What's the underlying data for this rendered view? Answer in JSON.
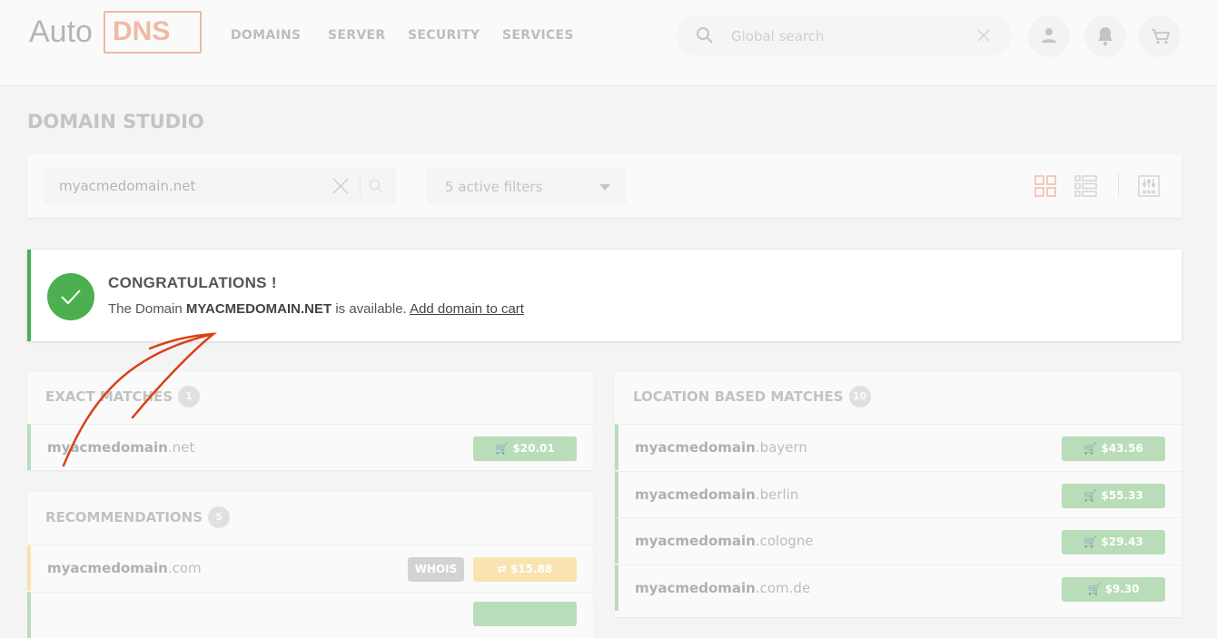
{
  "header": {
    "logo_auto": "Auto",
    "logo_dns": "DNS",
    "nav": [
      "DOMAINS",
      "SERVER",
      "SECURITY",
      "SERVICES"
    ],
    "search_placeholder": "Global search"
  },
  "page_title": "DOMAIN STUDIO",
  "search": {
    "value": "myacmedomain.net",
    "filters": "5 active filters"
  },
  "alert": {
    "title": "CONGRATULATIONS !",
    "pre": "The Domain ",
    "domain": "MYACMEDOMAIN.NET",
    "post": " is available. ",
    "link": "Add domain to cart",
    "color": "#4caf50"
  },
  "exact": {
    "title": "EXACT MATCHES",
    "count": "1",
    "rows": [
      {
        "name": "myacmedomain",
        "tld": ".net",
        "price": "$20.01"
      }
    ]
  },
  "recommendations": {
    "title": "RECOMMENDATIONS",
    "count": "5",
    "whois": "WHOIS",
    "rows": [
      {
        "name": "myacmedomain",
        "tld": ".com",
        "price": "$15.88"
      }
    ]
  },
  "location": {
    "title": "LOCATION BASED MATCHES",
    "count": "10",
    "rows": [
      {
        "name": "myacmedomain",
        "tld": ".bayern",
        "price": "$43.56"
      },
      {
        "name": "myacmedomain",
        "tld": ".berlin",
        "price": "$55.33"
      },
      {
        "name": "myacmedomain",
        "tld": ".cologne",
        "price": "$29.43"
      },
      {
        "name": "myacmedomain",
        "tld": ".com.de",
        "price": "$9.30"
      }
    ]
  },
  "colors": {
    "accent": "#f0b9a4",
    "annotation": "#d84315",
    "available": "#b9dcb9",
    "transfer": "#f9e3b1"
  }
}
